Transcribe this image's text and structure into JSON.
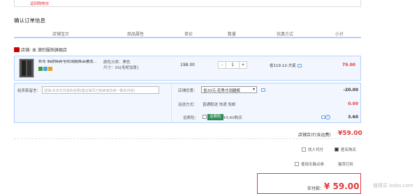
{
  "top": {
    "link": "返回购物车"
  },
  "section_title": "确认订单信息",
  "columns": [
    "店铺宝贝",
    "商品属性",
    "单价",
    "数量",
    "优惠方式",
    "小计"
  ],
  "shop": {
    "label": "店铺: ",
    "name": "本 澳钓服饰旗舰店"
  },
  "item": {
    "name": "秋冬 韩款韩新毛呢阔腿裤高腰宽...",
    "color": "颜色分类：黑色",
    "size": "尺寸：XS[毛呢加厚]",
    "price": "198.00",
    "qty": "1",
    "minus": "-",
    "plus": "+",
    "promo": "省119.12:大促",
    "subtotal": "79.00"
  },
  "message": {
    "label": "给卖家留言：",
    "placeholder": "选填:对本次交易的说明(建议填写已和卖家协商一致的内容)"
  },
  "shop_promo": {
    "label": "店铺优惠：",
    "value": "省20元:花秀才阔腿裤",
    "amount": "-20.00"
  },
  "shipping": {
    "label": "运送方式：",
    "value": "普通配送 快递 免邮",
    "amount": "0.00"
  },
  "insurance": {
    "label": "运费险：",
    "tag": "运费险",
    "text": "¥3.60购买",
    "amount": "3.60"
  },
  "shop_total": {
    "label": "店铺合计(含运费)",
    "value": "¥59.00"
  },
  "options": {
    "proxy": "找人代付",
    "anonymous": "匿名购买",
    "tmall_points": "使用天猫点券",
    "flag": "猫芽打折"
  },
  "pay": {
    "label": "实付款：",
    "value": "¥ 59.00"
  },
  "watermark": "值得买 bobo.com",
  "colors": {
    "accent": "#e4393c",
    "border": "#b2d1ff",
    "row_bg": "#f2f7ff"
  }
}
